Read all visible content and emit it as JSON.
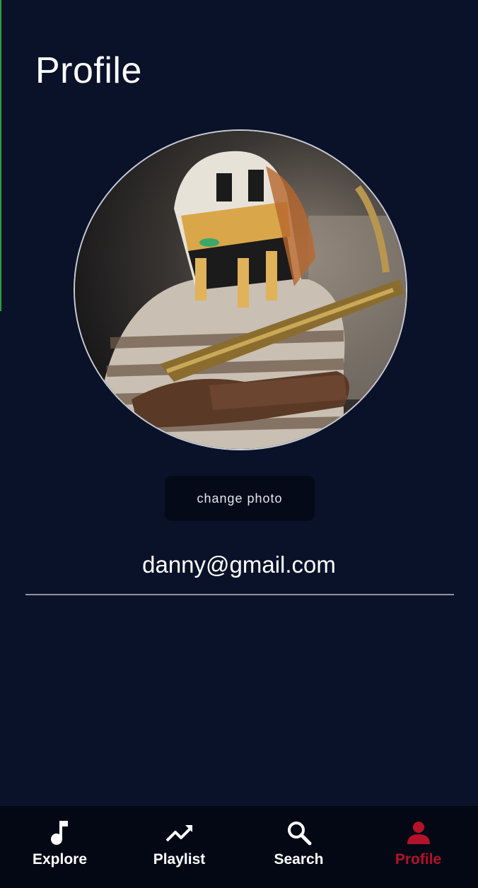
{
  "page": {
    "title": "Profile"
  },
  "profile": {
    "change_photo_label": "change photo",
    "email": "danny@gmail.com"
  },
  "nav": {
    "items": [
      {
        "label": "Explore",
        "icon": "music-note-icon",
        "active": false
      },
      {
        "label": "Playlist",
        "icon": "trending-up-icon",
        "active": false
      },
      {
        "label": "Search",
        "icon": "search-icon",
        "active": false
      },
      {
        "label": "Profile",
        "icon": "person-icon",
        "active": true
      }
    ]
  },
  "colors": {
    "background": "#0a1229",
    "nav_background": "#040815",
    "active": "#b3122a",
    "text": "#ffffff"
  }
}
